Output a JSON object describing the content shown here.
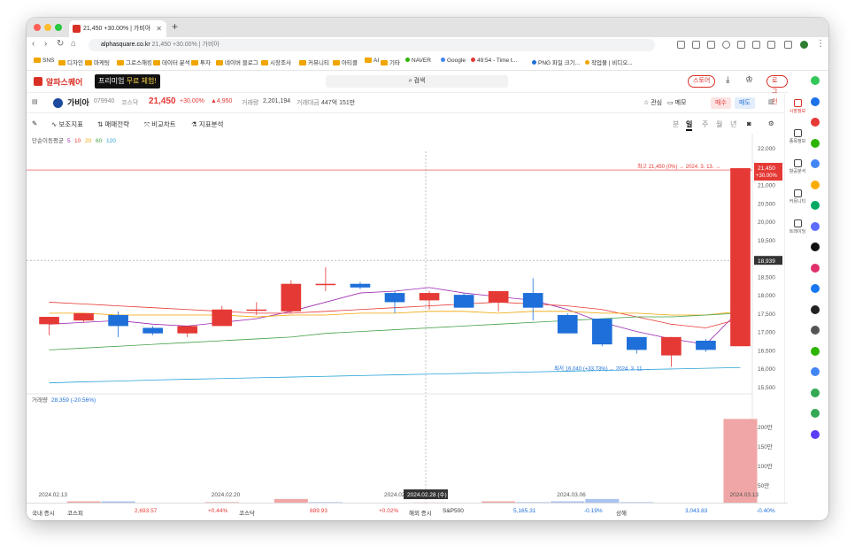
{
  "browser": {
    "tab_title": "21,450 +30.00% | 가비아",
    "url_host": "alphasquare.co.kr",
    "url_rest": "21,450 +30.00% | 가비아",
    "bookmarks": [
      "SNS",
      "디자인",
      "마케팅",
      "그로스해킹",
      "데이터 분석",
      "투자",
      "네이버 블로그",
      "시장조사",
      "커뮤니티",
      "아티클",
      "AI",
      "기타",
      "NAVER",
      "Google",
      "49:54 - Time t...",
      "PNG 파일 크기...",
      "작업물 | 비디오..."
    ]
  },
  "site": {
    "logo": "알파스퀘어",
    "promo_a": "프리미엄",
    "promo_b": "무료 체험!",
    "search_placeholder": "검색",
    "store": "스토어",
    "login": "로그인"
  },
  "stock": {
    "name": "가비아",
    "code": "079940",
    "market": "코스닥",
    "price": "21,450",
    "change_pct": "+30.00%",
    "change_abs": "▲4,950",
    "volume_label": "거래량",
    "volume": "2,201,194",
    "amount_label": "거래대금",
    "amount": "447억 151만",
    "watch": "관심",
    "memo": "메모",
    "buy": "매수",
    "sell": "매도"
  },
  "toolbar": {
    "aux": "보조지표",
    "strategy": "매매전략",
    "compare": "비교차트",
    "analysis": "지표분석",
    "periods": [
      "분",
      "일",
      "주",
      "월",
      "년"
    ],
    "selected_period": "일"
  },
  "chart_data": {
    "type": "candlestick",
    "ma_label": "단순이동평균",
    "ma_periods": [
      "5",
      "10",
      "20",
      "60",
      "120"
    ],
    "ma_colors": [
      "#9c27b0",
      "#e53935",
      "#f0a500",
      "#43a047",
      "#29a3d6"
    ],
    "ylim": [
      15400,
      22150
    ],
    "y_ticks": [
      "22,000",
      "21,500",
      "21,000",
      "20,500",
      "20,000",
      "19,500",
      "19,000",
      "18,500",
      "18,000",
      "17,500",
      "17,000",
      "16,500",
      "16,000",
      "15,500"
    ],
    "price_tag": "21,450",
    "price_tag_pct": "+30.00%",
    "crosshair_value": "18,939",
    "high_annotation": "최고 21,450 (0%) → 2024. 3. 13. →",
    "low_annotation": "최저 16,040 (+33.73%) ← 2024. 3. 11. →",
    "candles": [
      {
        "o": 17200,
        "h": 17350,
        "l": 16900,
        "c": 17400
      },
      {
        "o": 17300,
        "h": 17500,
        "l": 17250,
        "c": 17500
      },
      {
        "o": 17450,
        "h": 17550,
        "l": 16850,
        "c": 17150
      },
      {
        "o": 17100,
        "h": 17150,
        "l": 16900,
        "c": 16950
      },
      {
        "o": 16950,
        "h": 17150,
        "l": 16850,
        "c": 17150
      },
      {
        "o": 17150,
        "h": 17700,
        "l": 17150,
        "c": 17600
      },
      {
        "o": 17600,
        "h": 17800,
        "l": 17450,
        "c": 17600
      },
      {
        "o": 17550,
        "h": 18400,
        "l": 17500,
        "c": 18300
      },
      {
        "o": 18300,
        "h": 18750,
        "l": 18100,
        "c": 18300
      },
      {
        "o": 18300,
        "h": 18350,
        "l": 18150,
        "c": 18200
      },
      {
        "o": 18050,
        "h": 18100,
        "l": 17500,
        "c": 17800
      },
      {
        "o": 17850,
        "h": 18100,
        "l": 17600,
        "c": 18050
      },
      {
        "o": 18000,
        "h": 18050,
        "l": 17650,
        "c": 17650
      },
      {
        "o": 17800,
        "h": 18100,
        "l": 17550,
        "c": 18100
      },
      {
        "o": 18050,
        "h": 18450,
        "l": 17300,
        "c": 17650
      },
      {
        "o": 17450,
        "h": 17500,
        "l": 16950,
        "c": 16950
      },
      {
        "o": 17350,
        "h": 17350,
        "l": 16600,
        "c": 16650
      },
      {
        "o": 16850,
        "h": 16850,
        "l": 16400,
        "c": 16500
      },
      {
        "o": 16350,
        "h": 16850,
        "l": 16040,
        "c": 16850
      },
      {
        "o": 16750,
        "h": 16800,
        "l": 16450,
        "c": 16500
      },
      {
        "o": 16600,
        "h": 21450,
        "l": 16600,
        "c": 21450
      }
    ],
    "ma_lines": [
      [
        17200,
        17250,
        17300,
        17200,
        17150,
        17250,
        17350,
        17550,
        17800,
        18050,
        18100,
        18200,
        18050,
        17950,
        17850,
        17600,
        17250,
        17000,
        16800,
        16650,
        17600
      ],
      [
        17800,
        17750,
        17700,
        17650,
        17600,
        17550,
        17500,
        17500,
        17550,
        17600,
        17650,
        17700,
        17750,
        17800,
        17750,
        17700,
        17600,
        17400,
        17200,
        17100,
        17350
      ],
      [
        17500,
        17500,
        17450,
        17450,
        17450,
        17450,
        17400,
        17450,
        17450,
        17500,
        17500,
        17550,
        17550,
        17500,
        17550,
        17550,
        17500,
        17500,
        17450,
        17450,
        17550
      ],
      [
        16500,
        16550,
        16600,
        16650,
        16700,
        16750,
        16800,
        16850,
        16950,
        17000,
        17050,
        17100,
        17150,
        17200,
        17250,
        17300,
        17350,
        17400,
        17400,
        17450,
        17500
      ],
      [
        15600,
        15630,
        15650,
        15680,
        15700,
        15720,
        15740,
        15760,
        15780,
        15800,
        15820,
        15840,
        15860,
        15880,
        15900,
        15920,
        15940,
        15960,
        15980,
        16000,
        16020
      ]
    ],
    "volume_label": "거래량",
    "volume_value": "28,359 (-20.56%)",
    "volume_ticks": [
      "200만",
      "150만",
      "100만",
      "50만"
    ],
    "volumes": [
      4,
      8,
      8,
      4,
      4,
      6,
      4,
      14,
      6,
      4,
      4,
      5,
      4,
      8,
      6,
      8,
      14,
      6,
      4,
      4,
      220
    ],
    "volume_up": [
      true,
      true,
      false,
      false,
      true,
      true,
      true,
      true,
      false,
      false,
      false,
      true,
      false,
      true,
      false,
      false,
      false,
      false,
      true,
      false,
      true
    ],
    "x_dates": [
      "2024.02.13",
      "2024.02.20",
      "2024.02.27",
      "2024.03.06",
      "2024.03.13"
    ],
    "crosshair_date": "2024.02.28 (수)"
  },
  "sidebar": [
    {
      "label": "시장정보"
    },
    {
      "label": "종목정보"
    },
    {
      "label": "항공분석"
    },
    {
      "label": "커뮤니티"
    },
    {
      "label": "트레이딩"
    }
  ],
  "ticker": {
    "domestic": "국내 증시",
    "kospi_label": "코스피",
    "kospi_value": "2,693.57",
    "kospi_change": "+0.44%",
    "kosdaq_label": "코스닥",
    "kosdaq_value": "889.93",
    "kosdaq_change": "+0.02%",
    "foreign": "해외 증시",
    "sp_label": "S&P500",
    "sp_value": "5,165.31",
    "sp_change": "-0.19%",
    "sh_label": "상해",
    "sh_value": "3,043.83",
    "sh_change": "-0.40%"
  },
  "colors": {
    "up": "#e53935",
    "down": "#1e6fd9",
    "brand": "#d93025"
  }
}
